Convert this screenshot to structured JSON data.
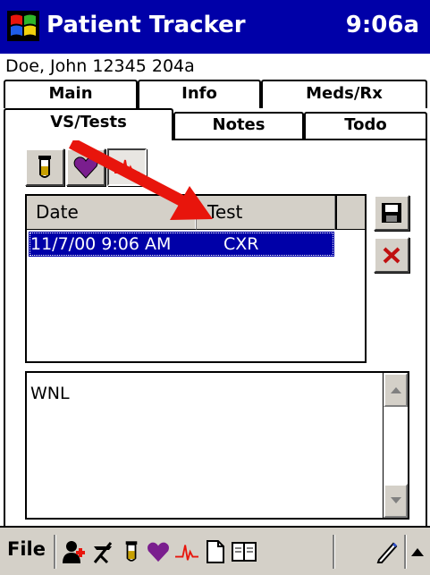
{
  "window": {
    "title": "Patient Tracker",
    "clock": "9:06a"
  },
  "patient": {
    "line": "Doe, John 12345 204a"
  },
  "tabs": {
    "row_back": [
      {
        "label": "Main"
      },
      {
        "label": "Info"
      },
      {
        "label": "Meds/Rx"
      }
    ],
    "row_front": [
      {
        "label": "VS/Tests",
        "active": true
      },
      {
        "label": "Notes"
      },
      {
        "label": "Todo"
      }
    ]
  },
  "toolbar": {
    "buttons": [
      {
        "icon": "test-tube-icon",
        "pressed": false
      },
      {
        "icon": "heart-icon",
        "pressed": false
      },
      {
        "icon": "ecg-icon",
        "pressed": true
      }
    ]
  },
  "list": {
    "columns": [
      "Date",
      "Test"
    ],
    "rows": [
      {
        "date": "11/7/00 9:06 AM",
        "test": "CXR",
        "selected": true
      }
    ]
  },
  "side_buttons": [
    {
      "icon": "save-icon"
    },
    {
      "icon": "delete-icon"
    }
  ],
  "notes": {
    "text": "WNL"
  },
  "menubar": {
    "file_label": "File",
    "icons": [
      "add-patient-icon",
      "caduceus-icon",
      "test-tube-icon",
      "heart-icon",
      "ecg-icon",
      "new-document-icon",
      "book-icon",
      "pen-icon",
      "up-arrow-icon"
    ]
  },
  "colors": {
    "titlebar": "#0000a8",
    "selection": "#0000a8",
    "arrow": "#e8150c",
    "face": "#d4d0c8"
  }
}
